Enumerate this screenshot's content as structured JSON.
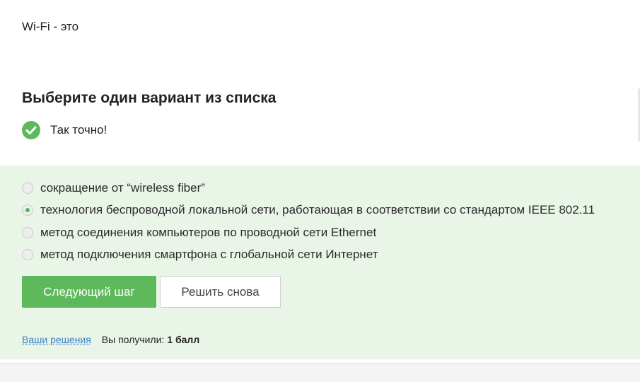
{
  "question": {
    "text": "Wi-Fi - это"
  },
  "instruction": "Выберите один вариант из списка",
  "feedback": {
    "text": "Так точно!",
    "icon": "check-circle-icon",
    "color": "#5db95a"
  },
  "options": [
    {
      "label": "сокращение от “wireless fiber”",
      "selected": false
    },
    {
      "label": "технология беспроводной локальной сети, работающая в соответствии со стандартом IEEE 802.11",
      "selected": true
    },
    {
      "label": "метод соединения компьютеров по проводной сети Ethernet",
      "selected": false
    },
    {
      "label": "метод подключения смартфона с глобальной сети Интернет",
      "selected": false
    }
  ],
  "buttons": {
    "next_step": "Следующий шаг",
    "retry": "Решить снова"
  },
  "footer": {
    "solutions_link": "Ваши решения",
    "score_label": "Вы получили:",
    "score_value": "1 балл"
  },
  "colors": {
    "accent": "#5db95a",
    "panel_bg": "#e9f5e7",
    "link": "#3a82c4"
  }
}
